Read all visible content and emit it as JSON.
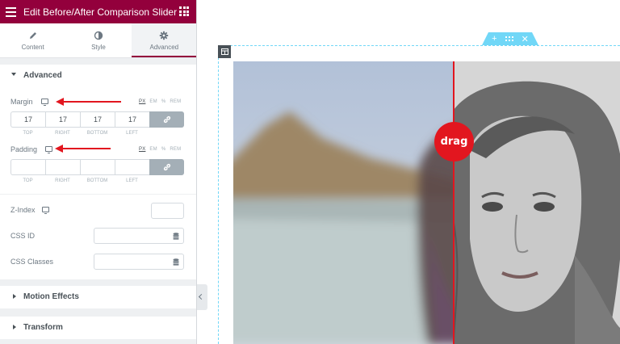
{
  "topbar": {
    "title": "Edit Before/After Comparison Slider",
    "menu_icon": "hamburger-icon",
    "widgets_icon": "grid-icon",
    "bg_color": "#93003c"
  },
  "tabs": [
    {
      "label": "Content",
      "icon": "pencil-icon",
      "active": false
    },
    {
      "label": "Style",
      "icon": "contrast-icon",
      "active": false
    },
    {
      "label": "Advanced",
      "icon": "gear-icon",
      "active": true
    }
  ],
  "advanced": {
    "section_title": "Advanced",
    "units": [
      "PX",
      "EM",
      "%",
      "REM"
    ],
    "selected_unit": "PX",
    "dimension_labels": [
      "TOP",
      "RIGHT",
      "BOTTOM",
      "LEFT"
    ],
    "margin": {
      "label": "Margin",
      "top": "17",
      "right": "17",
      "bottom": "17",
      "left": "17"
    },
    "padding": {
      "label": "Padding",
      "top": "",
      "right": "",
      "bottom": "",
      "left": ""
    },
    "z_index": {
      "label": "Z-Index",
      "value": ""
    },
    "css_id": {
      "label": "CSS ID",
      "value": ""
    },
    "css_classes": {
      "label": "CSS Classes",
      "value": ""
    }
  },
  "sections": {
    "motion_effects": "Motion Effects",
    "transform": "Transform"
  },
  "preview": {
    "handle_icons": [
      "plus-icon",
      "drag-handle-icon",
      "close-icon"
    ],
    "slider_button": "drag",
    "accent_color": "#e2161f",
    "frame_color": "#71d7f7"
  }
}
